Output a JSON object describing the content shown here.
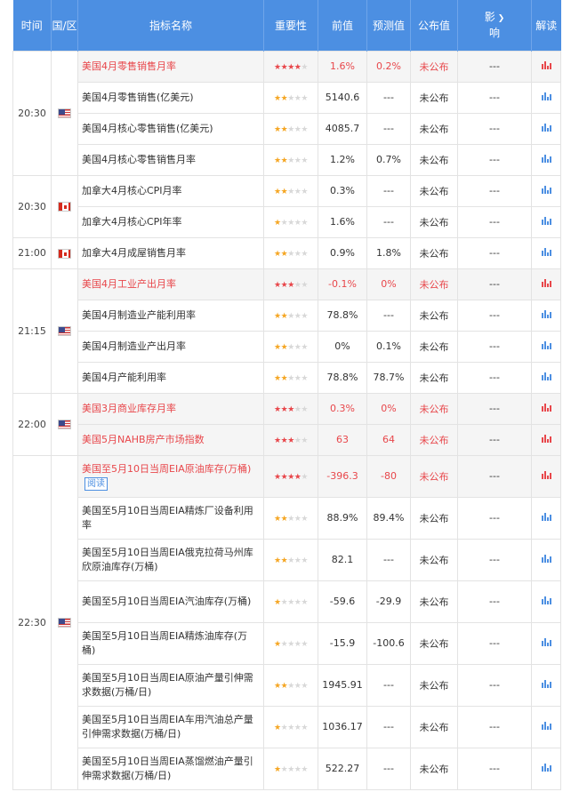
{
  "headers": {
    "time": "时间",
    "region": "国/区",
    "name": "指标名称",
    "importance": "重要性",
    "prev": "前值",
    "forecast": "预测值",
    "actual": "公布值",
    "impact_1": "影",
    "impact_2": "响",
    "interpret": "解读"
  },
  "read_label": "阅读",
  "groups": [
    {
      "time": "20:30",
      "country": "us",
      "rows": [
        {
          "name": "美国4月零售销售月率",
          "stars": 4,
          "prev": "1.6%",
          "forecast": "0.2%",
          "actual": "未公布",
          "impact": "---",
          "hl": true
        },
        {
          "name": "美国4月零售销售(亿美元)",
          "stars": 2,
          "prev": "5140.6",
          "forecast": "---",
          "actual": "未公布",
          "impact": "---",
          "hl": false
        },
        {
          "name": "美国4月核心零售销售(亿美元)",
          "stars": 2,
          "prev": "4085.7",
          "forecast": "---",
          "actual": "未公布",
          "impact": "---",
          "hl": false
        },
        {
          "name": "美国4月核心零售销售月率",
          "stars": 2,
          "prev": "1.2%",
          "forecast": "0.7%",
          "actual": "未公布",
          "impact": "---",
          "hl": false
        }
      ]
    },
    {
      "time": "20:30",
      "country": "ca",
      "rows": [
        {
          "name": "加拿大4月核心CPI月率",
          "stars": 2,
          "prev": "0.3%",
          "forecast": "---",
          "actual": "未公布",
          "impact": "---",
          "hl": false
        },
        {
          "name": "加拿大4月核心CPI年率",
          "stars": 1,
          "prev": "1.6%",
          "forecast": "---",
          "actual": "未公布",
          "impact": "---",
          "hl": false
        }
      ]
    },
    {
      "time": "21:00",
      "country": "ca",
      "rows": [
        {
          "name": "加拿大4月成屋销售月率",
          "stars": 2,
          "prev": "0.9%",
          "forecast": "1.8%",
          "actual": "未公布",
          "impact": "---",
          "hl": false
        }
      ]
    },
    {
      "time": "21:15",
      "country": "us",
      "rows": [
        {
          "name": "美国4月工业产出月率",
          "stars": 3,
          "prev": "-0.1%",
          "forecast": "0%",
          "actual": "未公布",
          "impact": "---",
          "hl": true
        },
        {
          "name": "美国4月制造业产能利用率",
          "stars": 2,
          "prev": "78.8%",
          "forecast": "---",
          "actual": "未公布",
          "impact": "---",
          "hl": false
        },
        {
          "name": "美国4月制造业产出月率",
          "stars": 2,
          "prev": "0%",
          "forecast": "0.1%",
          "actual": "未公布",
          "impact": "---",
          "hl": false
        },
        {
          "name": "美国4月产能利用率",
          "stars": 2,
          "prev": "78.8%",
          "forecast": "78.7%",
          "actual": "未公布",
          "impact": "---",
          "hl": false
        }
      ]
    },
    {
      "time": "22:00",
      "country": "us",
      "rows": [
        {
          "name": "美国3月商业库存月率",
          "stars": 3,
          "prev": "0.3%",
          "forecast": "0%",
          "actual": "未公布",
          "impact": "---",
          "hl": true
        },
        {
          "name": "美国5月NAHB房产市场指数",
          "stars": 3,
          "prev": "63",
          "forecast": "64",
          "actual": "未公布",
          "impact": "---",
          "hl": true
        }
      ]
    },
    {
      "time": "22:30",
      "country": "us",
      "rows": [
        {
          "name": "美国至5月10日当周EIA原油库存(万桶)",
          "stars": 4,
          "prev": "-396.3",
          "forecast": "-80",
          "actual": "未公布",
          "impact": "---",
          "hl": true,
          "read": true,
          "tall": true
        },
        {
          "name": "美国至5月10日当周EIA精炼厂设备利用率",
          "stars": 2,
          "prev": "88.9%",
          "forecast": "89.4%",
          "actual": "未公布",
          "impact": "---",
          "hl": false,
          "tall": true
        },
        {
          "name": "美国至5月10日当周EIA俄克拉荷马州库欣原油库存(万桶)",
          "stars": 2,
          "prev": "82.1",
          "forecast": "---",
          "actual": "未公布",
          "impact": "---",
          "hl": false,
          "tall": true
        },
        {
          "name": "美国至5月10日当周EIA汽油库存(万桶)",
          "stars": 1,
          "prev": "-59.6",
          "forecast": "-29.9",
          "actual": "未公布",
          "impact": "---",
          "hl": false,
          "tall": true
        },
        {
          "name": "美国至5月10日当周EIA精炼油库存(万桶)",
          "stars": 1,
          "prev": "-15.9",
          "forecast": "-100.6",
          "actual": "未公布",
          "impact": "---",
          "hl": false,
          "tall": true
        },
        {
          "name": "美国至5月10日当周EIA原油产量引伸需求数据(万桶/日)",
          "stars": 2,
          "prev": "1945.91",
          "forecast": "---",
          "actual": "未公布",
          "impact": "---",
          "hl": false,
          "tall": true
        },
        {
          "name": "美国至5月10日当周EIA车用汽油总产量引伸需求数据(万桶/日)",
          "stars": 1,
          "prev": "1036.17",
          "forecast": "---",
          "actual": "未公布",
          "impact": "---",
          "hl": false,
          "tall": true
        },
        {
          "name": "美国至5月10日当周EIA蒸馏燃油产量引伸需求数据(万桶/日)",
          "stars": 1,
          "prev": "522.27",
          "forecast": "---",
          "actual": "未公布",
          "impact": "---",
          "hl": false,
          "tall": true
        }
      ]
    }
  ]
}
